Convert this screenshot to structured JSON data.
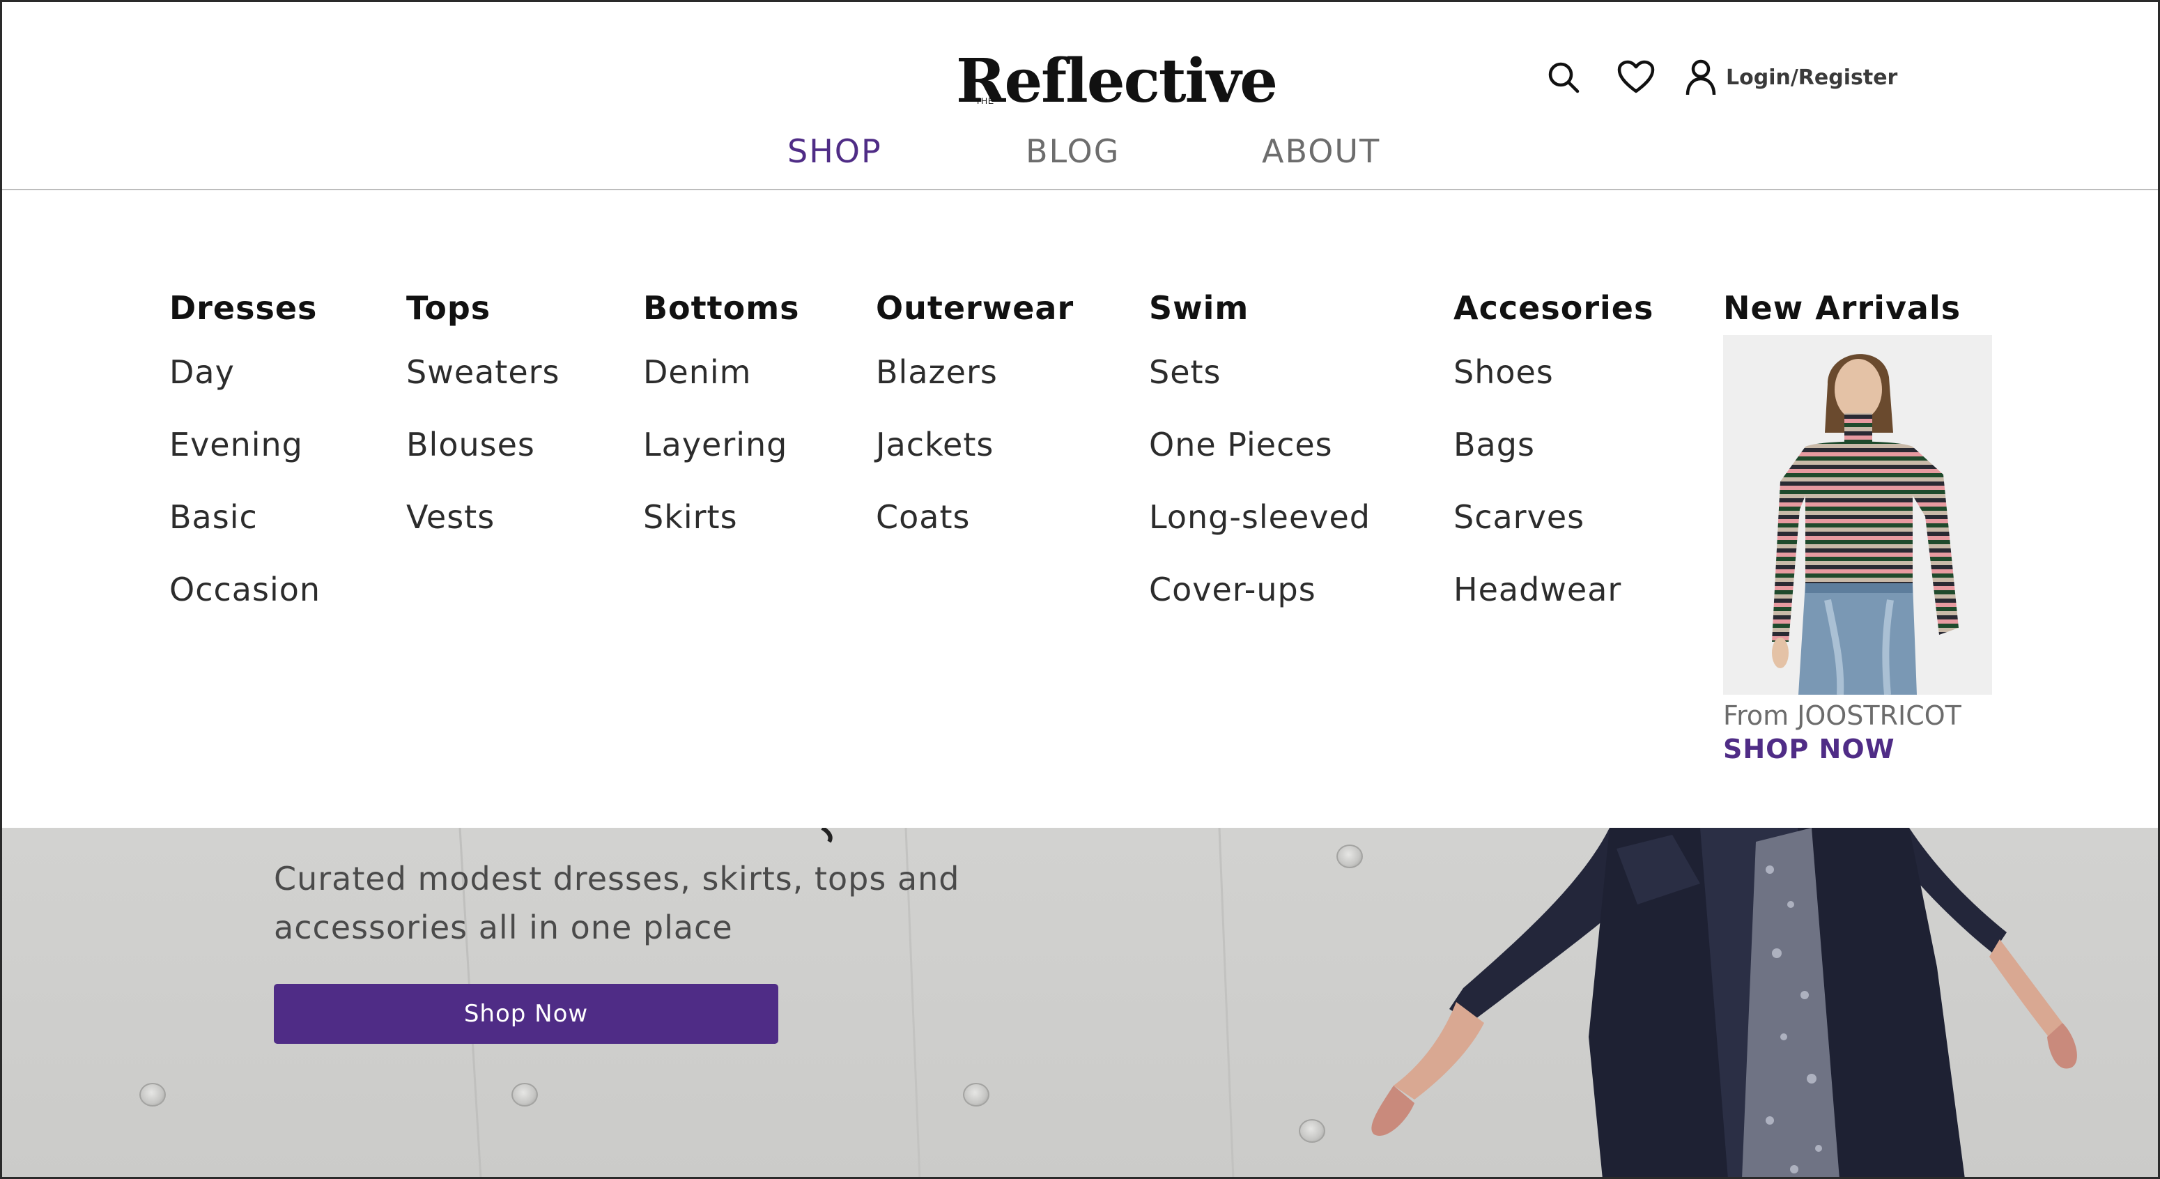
{
  "brand": {
    "name": "Reflective",
    "prefix": "THE"
  },
  "header": {
    "login_label": "Login/Register",
    "icons": [
      "search-icon",
      "heart-icon",
      "user-icon"
    ]
  },
  "nav": {
    "items": [
      {
        "label": "SHOP",
        "active": true
      },
      {
        "label": "BLOG",
        "active": false
      },
      {
        "label": "ABOUT",
        "active": false
      }
    ]
  },
  "mega_menu": {
    "columns": [
      {
        "title": "Dresses",
        "items": [
          "Day",
          "Evening",
          "Basic",
          "Occasion"
        ]
      },
      {
        "title": "Tops",
        "items": [
          "Sweaters",
          "Blouses",
          "Vests"
        ]
      },
      {
        "title": "Bottoms",
        "items": [
          "Denim",
          "Layering",
          "Skirts"
        ]
      },
      {
        "title": "Outerwear",
        "items": [
          "Blazers",
          "Jackets",
          "Coats"
        ]
      },
      {
        "title": "Swim",
        "items": [
          "Sets",
          "One Pieces",
          "Long-sleeved",
          "Cover-ups"
        ]
      },
      {
        "title": "Accesories",
        "items": [
          "Shoes",
          "Bags",
          "Scarves",
          "Headwear"
        ]
      }
    ],
    "new_arrivals": {
      "title": "New Arrivals",
      "from_text": "From JOOSTRICOT",
      "link_label": "SHOP NOW"
    }
  },
  "hero": {
    "tagline_line1": "Curated modest dresses, skirts, tops and",
    "tagline_line2": "accessories all in one place",
    "button_label": "Shop Now"
  },
  "colors": {
    "accent": "#4f2c86",
    "nav_inactive": "#6d6d6d",
    "hero_bg": "#cecece"
  }
}
